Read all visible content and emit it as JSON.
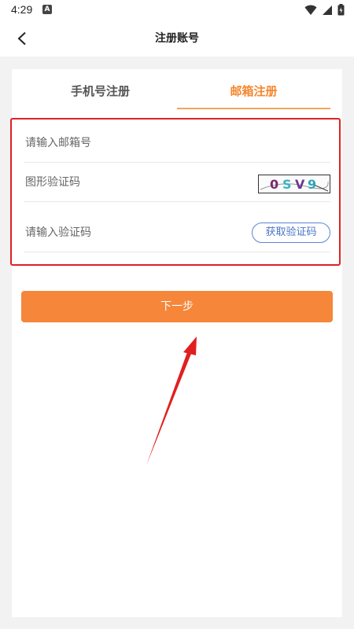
{
  "status_bar": {
    "time": "4:29",
    "notification_letter": "A"
  },
  "header": {
    "title": "注册账号",
    "back_icon": "chevron-left-icon"
  },
  "tabs": [
    {
      "label": "手机号注册",
      "active": false
    },
    {
      "label": "邮箱注册",
      "active": true
    }
  ],
  "form": {
    "email_placeholder": "请输入邮箱号",
    "captcha_placeholder": "图形验证码",
    "captcha_text": "0SV9",
    "code_placeholder": "请输入验证码",
    "get_code_label": "获取验证码"
  },
  "next_label": "下一步",
  "colors": {
    "accent": "#f5863a",
    "highlight_border": "#e02020",
    "link_blue": "#4a74c9"
  }
}
